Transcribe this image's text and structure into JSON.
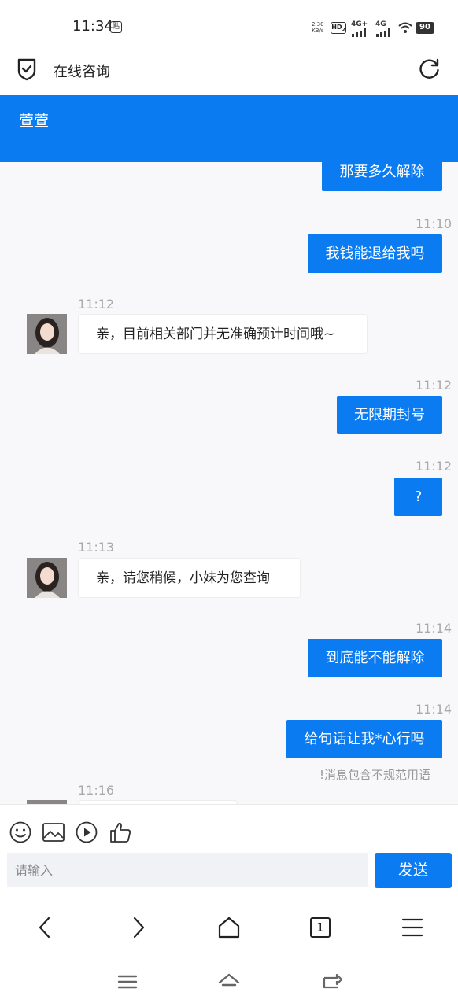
{
  "status_bar": {
    "time": "11:34",
    "tie_icon_text": "贴",
    "net_speed_value": "2.30",
    "net_speed_unit": "KB/s",
    "hd_label": "HD",
    "hd_sub": "2",
    "signal_1": "4G+",
    "signal_2": "4G",
    "battery": "90"
  },
  "app_bar": {
    "title": "在线咨询"
  },
  "chat_header": {
    "agent_name": "萱萱"
  },
  "messages": [
    {
      "from": "user",
      "text": "那要多久解除"
    },
    {
      "from": "user",
      "time": "11:10",
      "text": "我钱能退给我吗"
    },
    {
      "from": "agent",
      "time": "11:12",
      "text": "亲，目前相关部门并无准确预计时间哦~"
    },
    {
      "from": "user",
      "time": "11:12",
      "text": "无限期封号"
    },
    {
      "from": "user",
      "time": "11:12",
      "text": "?"
    },
    {
      "from": "agent",
      "time": "11:13",
      "text": "亲，请您稍候，小妹为您查询"
    },
    {
      "from": "user",
      "time": "11:14",
      "text": "到底能不能解除"
    },
    {
      "from": "user",
      "time": "11:14",
      "text": "给句话让我*心行吗",
      "warning": "!消息包含不规范用语"
    },
    {
      "from": "agent",
      "time": "11:16",
      "text": ""
    }
  ],
  "input": {
    "placeholder": "请输入",
    "send_label": "发送"
  },
  "browser_nav": {
    "tab_count": "1"
  },
  "colors": {
    "accent": "#0a7bf1",
    "chat_bg": "#f8f8fa",
    "input_bg": "#f1f2f6"
  },
  "icons": {
    "toolbar": [
      "emoji-icon",
      "image-icon",
      "video-icon",
      "thumbs-up-icon"
    ],
    "browser_nav": [
      "back-icon",
      "forward-icon",
      "home-icon",
      "tabs-icon",
      "menu-icon"
    ],
    "system_nav": [
      "recent-apps-icon",
      "system-home-icon",
      "system-back-icon"
    ]
  }
}
